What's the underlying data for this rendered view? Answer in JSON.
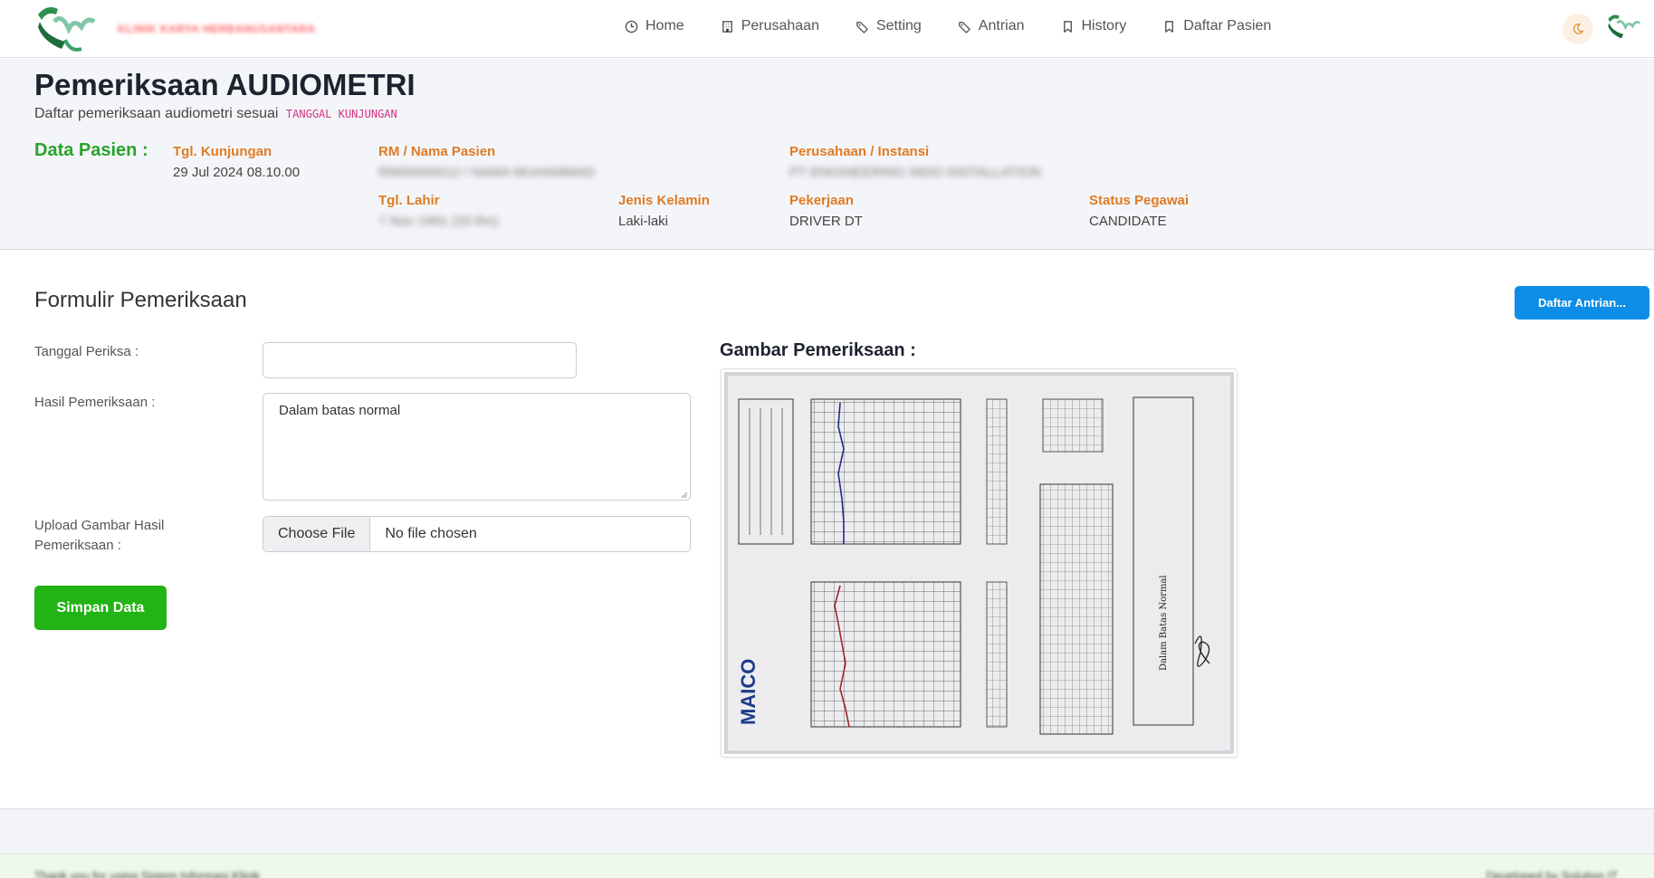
{
  "nav": {
    "brand_name": "KLINIK KARYA HERBANUSANTARA",
    "items": [
      {
        "label": "Home",
        "icon": "clock-icon"
      },
      {
        "label": "Perusahaan",
        "icon": "building-icon"
      },
      {
        "label": "Setting",
        "icon": "tag-icon"
      },
      {
        "label": "Antrian",
        "icon": "tag-icon"
      },
      {
        "label": "History",
        "icon": "bookmark-icon"
      },
      {
        "label": "Daftar Pasien",
        "icon": "bookmark-icon"
      }
    ]
  },
  "header": {
    "title": "Pemeriksaan AUDIOMETRI",
    "subtitle": "Daftar pemeriksaan audiometri sesuai",
    "subtitle_code": "TANGGAL KUNJUNGAN",
    "data_pasien_label": "Data Pasien :",
    "fields": {
      "tgl_kunjungan": {
        "label": "Tgl. Kunjungan",
        "value": "29 Jul 2024 08.10.00"
      },
      "rm_nama": {
        "label": "RM / Nama Pasien",
        "value": "RM00000012 / NAMA MUHAMMAD"
      },
      "perusahaan": {
        "label": "Perusahaan / Instansi",
        "value": "PT ENGINEERING INDO INSTALLATION"
      },
      "tgl_lahir": {
        "label": "Tgl. Lahir",
        "value": "7 Nov 1991 (33 thn)"
      },
      "jenis_kelamin": {
        "label": "Jenis Kelamin",
        "value": "Laki-laki"
      },
      "pekerjaan": {
        "label": "Pekerjaan",
        "value": "DRIVER DT"
      },
      "status_pegawai": {
        "label": "Status Pegawai",
        "value": "CANDIDATE"
      }
    }
  },
  "form": {
    "title": "Formulir Pemeriksaan",
    "queue_button": "Daftar Antrian...",
    "tanggal_label": "Tanggal Periksa :",
    "tanggal_value": "",
    "hasil_label": "Hasil Pemeriksaan :",
    "hasil_value": "Dalam batas normal",
    "upload_label": "Upload Gambar Hasil Pemeriksaan :",
    "file_button": "Choose File",
    "file_status": "No file chosen",
    "save_button": "Simpan Data",
    "gambar_title": "Gambar Pemeriksaan :"
  },
  "audiogram": {
    "brand": "MAICO",
    "handwritten_note": "Dalam Batas Normal"
  },
  "footer": {
    "left_text": "Thank you for using Sistem Informasi Klinik",
    "right_text": "Developed by Solution IT"
  },
  "colors": {
    "brand_green": "#22b314",
    "label_orange": "#e07b24",
    "primary_blue": "#0d8de6",
    "code_pink": "#d63384"
  }
}
